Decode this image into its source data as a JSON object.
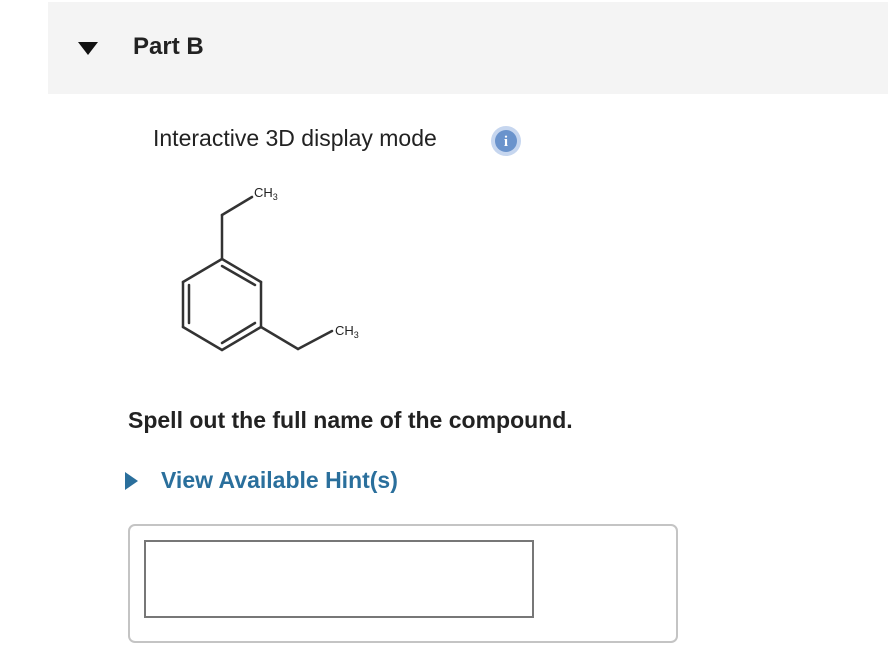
{
  "part": {
    "title": "Part B",
    "toggle_icon": "triangle-down-icon"
  },
  "display_mode": {
    "label": "Interactive 3D display mode",
    "info_icon": "info-icon",
    "info_icon_text": "i",
    "info_color": "#6a93cc"
  },
  "molecule": {
    "substituent_top": "CH",
    "substituent_top_subscript": "3",
    "substituent_right": "CH",
    "substituent_right_subscript": "3"
  },
  "question": {
    "text": "Spell out the full name of the compound."
  },
  "hint": {
    "label": "View Available Hint(s)",
    "icon": "triangle-right-icon",
    "color": "#2a6f9c"
  },
  "answer": {
    "value": "",
    "placeholder": ""
  }
}
